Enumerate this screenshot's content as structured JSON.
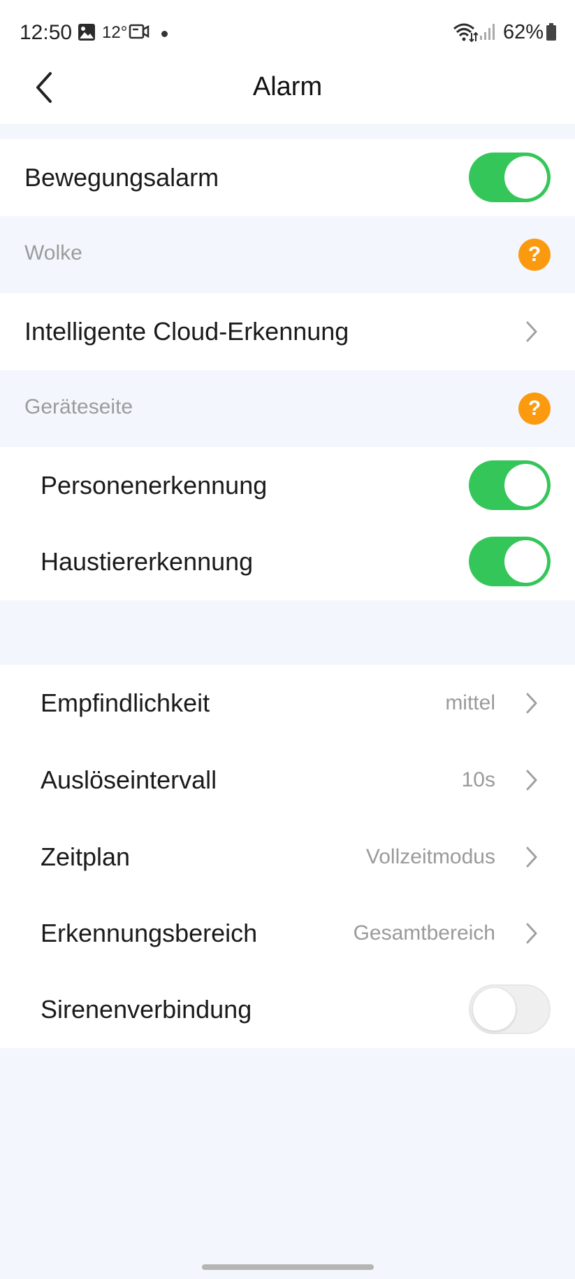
{
  "status_bar": {
    "time": "12:50",
    "temperature": "12°",
    "battery": "62%",
    "icons": [
      "gallery-icon",
      "video-camera-icon",
      "notification-dot-icon",
      "wifi-icon",
      "signal-icon",
      "battery-icon"
    ]
  },
  "header": {
    "title": "Alarm",
    "back_icon": "chevron-left-icon"
  },
  "motion_alarm": {
    "label": "Bewegungsalarm",
    "enabled": true
  },
  "cloud_section": {
    "header": "Wolke",
    "help_symbol": "?",
    "items": [
      {
        "label": "Intelligente Cloud-Erkennung"
      }
    ]
  },
  "device_section": {
    "header": "Geräteseite",
    "help_symbol": "?",
    "items": [
      {
        "label": "Personenerkennung",
        "enabled": true
      },
      {
        "label": "Haustiererkennung",
        "enabled": true
      }
    ]
  },
  "settings": {
    "items": [
      {
        "label": "Empfindlichkeit",
        "value": "mittel"
      },
      {
        "label": "Auslöseintervall",
        "value": "10s"
      },
      {
        "label": "Zeitplan",
        "value": "Vollzeitmodus"
      },
      {
        "label": "Erkennungsbereich",
        "value": "Gesamtbereich"
      }
    ],
    "siren": {
      "label": "Sirenenverbindung",
      "enabled": false
    }
  },
  "colors": {
    "accent_green": "#35c65a",
    "help_orange": "#fb9a0e",
    "background": "#f3f6fc"
  }
}
